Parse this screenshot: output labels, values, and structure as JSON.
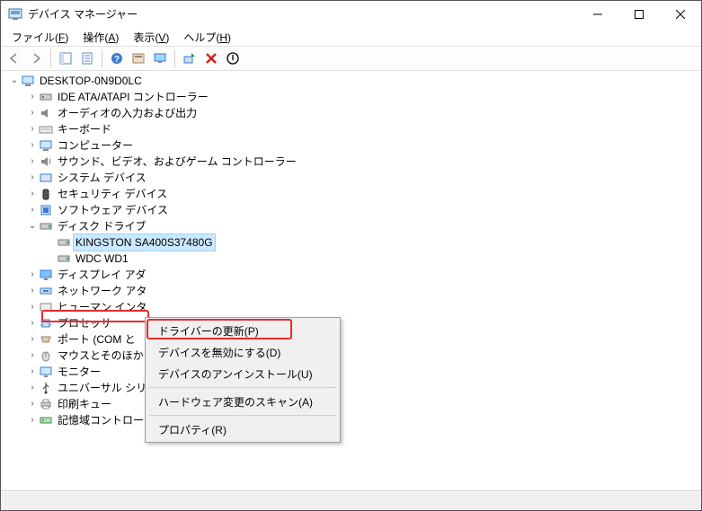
{
  "window": {
    "title": "デバイス マネージャー"
  },
  "menus": {
    "file": "ファイル(",
    "file_accel": "F",
    "file_end": ")",
    "action": "操作(",
    "action_accel": "A",
    "action_end": ")",
    "view": "表示(",
    "view_accel": "V",
    "view_end": ")",
    "help": "ヘルプ(",
    "help_accel": "H",
    "help_end": ")"
  },
  "tree": {
    "root": "DESKTOP-0N9D0LC",
    "nodes": {
      "ide": "IDE ATA/ATAPI コントローラー",
      "audio": "オーディオの入力および出力",
      "keyboard": "キーボード",
      "computer": "コンピューター",
      "svg_audio": "サウンド、ビデオ、およびゲーム コントローラー",
      "system": "システム デバイス",
      "security": "セキュリティ デバイス",
      "software": "ソフトウェア デバイス",
      "disk": "ディスク ドライブ",
      "kingston": "KINGSTON SA400S37480G",
      "wdc": "WDC WD1",
      "display": "ディスプレイ アダ",
      "network": "ネットワーク アタ",
      "hid": "ヒューマン インタ",
      "cpu": "プロセッサ",
      "ports": "ポート (COM と",
      "mouse": "マウスとそのほか",
      "monitor": "モニター",
      "usb": "ユニバーサル シリアル バス コントローラー",
      "print": "印刷キュー",
      "storage": "記憶域コントローラー"
    }
  },
  "context": {
    "update": "ドライバーの更新(P)",
    "disable": "デバイスを無効にする(D)",
    "uninstall": "デバイスのアンインストール(U)",
    "scan": "ハードウェア変更のスキャン(A)",
    "properties": "プロパティ(R)"
  }
}
